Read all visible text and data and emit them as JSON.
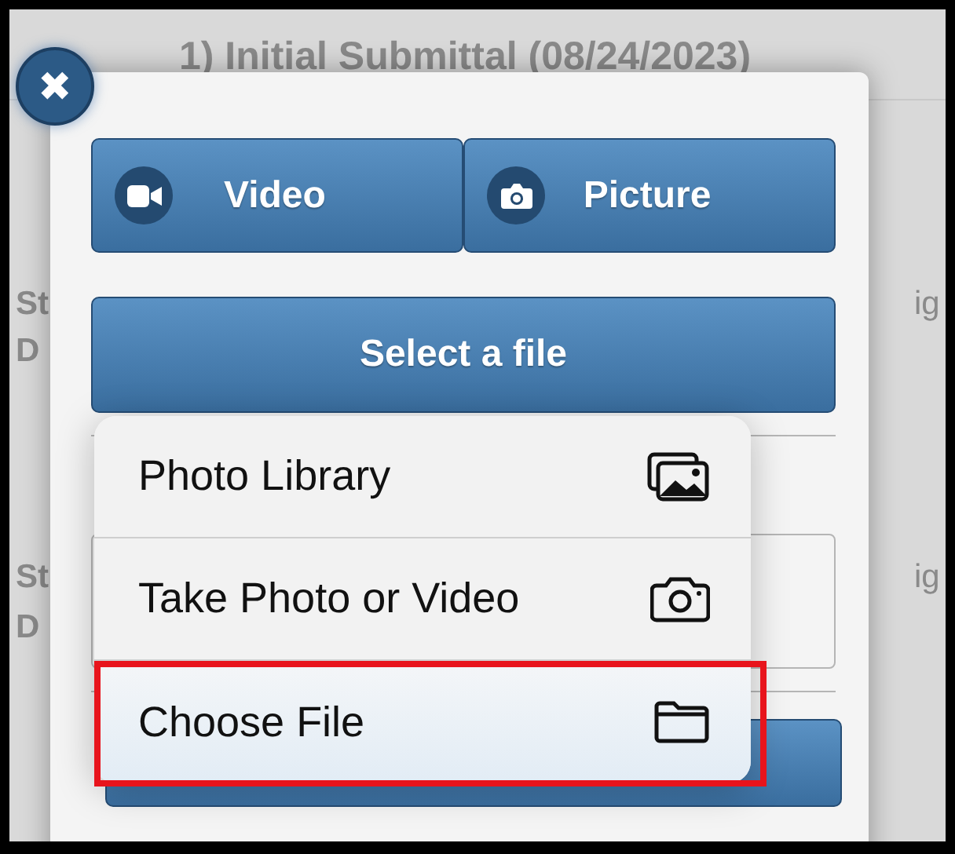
{
  "background": {
    "heading": "1) Initial Submittal (08/24/2023)",
    "left_fragments": [
      "St",
      "D",
      "St",
      "D"
    ],
    "right_fragments": [
      "ig",
      "ig"
    ]
  },
  "modal": {
    "close_label": "✖",
    "media_buttons": [
      {
        "label": "Video",
        "kind": "video"
      },
      {
        "label": "Picture",
        "kind": "camera"
      }
    ],
    "select_button": "Select a file"
  },
  "menu": {
    "items": [
      {
        "label": "Photo Library",
        "kind": "photos",
        "selected": false,
        "annotated": false
      },
      {
        "label": "Take Photo or Video",
        "kind": "camera",
        "selected": false,
        "annotated": false
      },
      {
        "label": "Choose File",
        "kind": "folder",
        "selected": true,
        "annotated": true
      }
    ]
  }
}
